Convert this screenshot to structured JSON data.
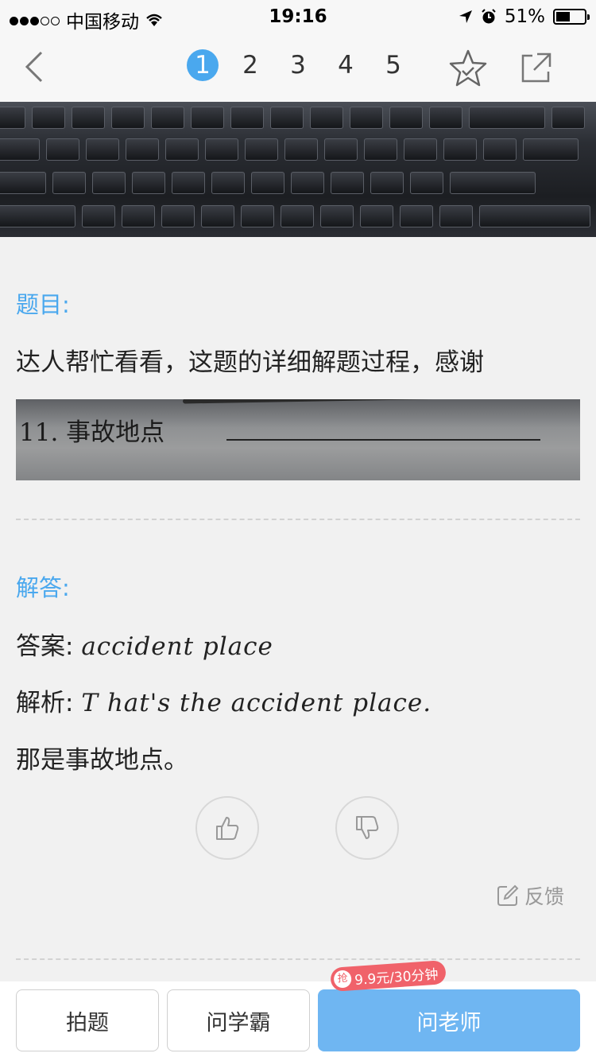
{
  "status_bar": {
    "carrier": "中国移动",
    "time": "19:16",
    "battery": "51%",
    "battery_level": 0.51
  },
  "nav": {
    "pages": [
      "1",
      "2",
      "3",
      "4",
      "5"
    ],
    "active_page": "1"
  },
  "question": {
    "label": "题目:",
    "text": "达人帮忙看看，这题的详细解题过程，感谢",
    "photo_text": "11. 事故地点"
  },
  "answer": {
    "label": "解答:",
    "answer_prefix": "答案:",
    "answer_math": "accident place",
    "analysis_prefix": "解析:",
    "analysis_math": "T hat's the accident place.",
    "translation": "那是事故地点。"
  },
  "feedback_label": "反馈",
  "bottom": {
    "photo_btn": "拍题",
    "ask_top_btn": "问学霸",
    "ask_teacher_btn": "问老师",
    "promo_grab": "抢",
    "promo_text": "9.9元/30分钟"
  },
  "colors": {
    "accent": "#4aa8ee",
    "primary_button": "#6fb6f2",
    "promo": "#f0626a"
  }
}
